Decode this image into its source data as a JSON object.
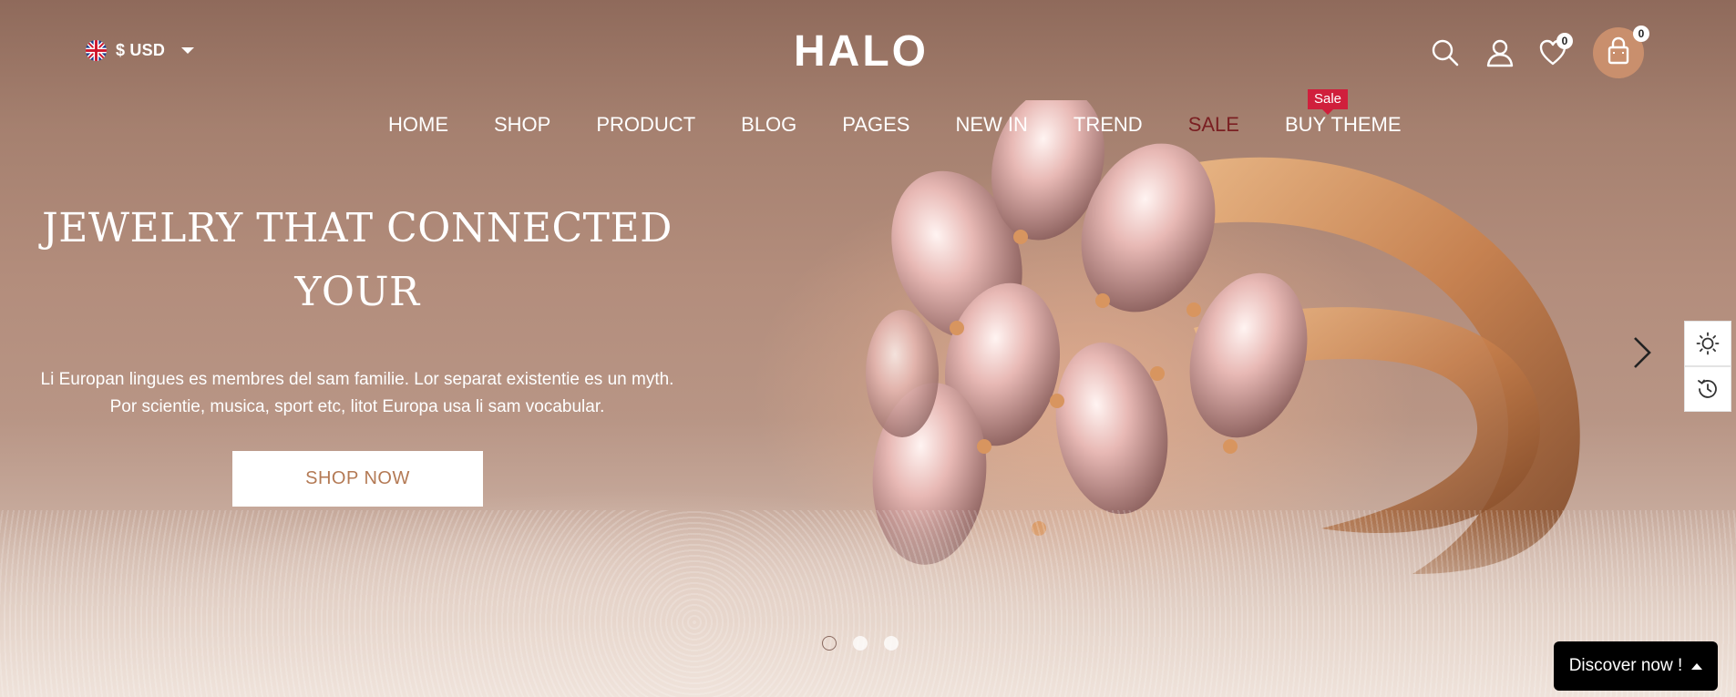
{
  "header": {
    "currency_label": "$ USD",
    "logo_text": "HALO",
    "wishlist_count": "0",
    "cart_count": "0"
  },
  "nav": {
    "items": [
      {
        "label": "HOME"
      },
      {
        "label": "SHOP"
      },
      {
        "label": "PRODUCT"
      },
      {
        "label": "BLOG"
      },
      {
        "label": "PAGES"
      },
      {
        "label": "NEW IN"
      },
      {
        "label": "TREND"
      },
      {
        "label": "SALE"
      },
      {
        "label": "BUY THEME"
      }
    ],
    "sale_tag": "Sale"
  },
  "hero": {
    "headline": "JEWELRY THAT CONNECTED YOUR",
    "description": "Li Europan lingues es membres del sam familie. Lor separat existentie es un myth. Por scientie, musica, sport etc, litot Europa usa li sam vocabular.",
    "cta_label": "SHOP NOW",
    "slides": 3,
    "active_slide": 1
  },
  "floating": {
    "discover_label": "Discover now !"
  },
  "colors": {
    "accent": "#c98f6d",
    "cta_text": "#b47a55",
    "sale_tag_bg": "#d01f3c",
    "sale_nav_text": "#7a1f22"
  },
  "icons": [
    "uk-flag-icon",
    "caret-down-icon",
    "search-icon",
    "user-icon",
    "heart-icon",
    "bag-icon",
    "chevron-right-icon",
    "sun-icon",
    "history-icon",
    "caret-up-icon"
  ]
}
